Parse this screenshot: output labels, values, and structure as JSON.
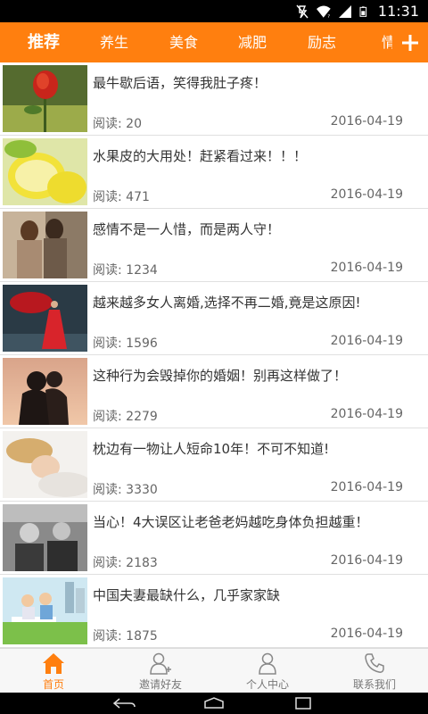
{
  "status_bar": {
    "time": "11:31"
  },
  "tabs": [
    {
      "label": "推荐",
      "active": true
    },
    {
      "label": "养生"
    },
    {
      "label": "美食"
    },
    {
      "label": "减肥"
    },
    {
      "label": "励志"
    },
    {
      "label": "情"
    }
  ],
  "add_icon": "plus-icon",
  "articles": [
    {
      "title": "最牛歇后语，笑得我肚子疼！",
      "reads": "阅读: 20",
      "date": "2016-04-19",
      "thumb": "red-rose"
    },
    {
      "title": "水果皮的大用处！赶紧看过来！！！",
      "reads": "阅读: 471",
      "date": "2016-04-19",
      "thumb": "lemon"
    },
    {
      "title": "感情不是一人惜，而是两人守！",
      "reads": "阅读: 1234",
      "date": "2016-04-19",
      "thumb": "couple-hug"
    },
    {
      "title": "越来越多女人离婚,选择不再二婚,竟是这原因!",
      "reads": "阅读: 1596",
      "date": "2016-04-19",
      "thumb": "woman-red-dress"
    },
    {
      "title": "这种行为会毁掉你的婚姻！别再这样做了！",
      "reads": "阅读: 2279",
      "date": "2016-04-19",
      "thumb": "couple-silhouette"
    },
    {
      "title": "枕边有一物让人短命10年！不可不知道!",
      "reads": "阅读: 3330",
      "date": "2016-04-19",
      "thumb": "sleeping-woman"
    },
    {
      "title": "当心！4大误区让老爸老妈越吃身体负担越重！",
      "reads": "阅读: 2183",
      "date": "2016-04-19",
      "thumb": "elderly-couple"
    },
    {
      "title": "中国夫妻最缺什么，几乎家家缺",
      "reads": "阅读: 1875",
      "date": "2016-04-19",
      "thumb": "cartoon-couple"
    }
  ],
  "bottom_nav": [
    {
      "label": "首页",
      "icon": "home-icon",
      "active": true
    },
    {
      "label": "邀请好友",
      "icon": "add-friend-icon"
    },
    {
      "label": "个人中心",
      "icon": "person-icon"
    },
    {
      "label": "联系我们",
      "icon": "phone-icon"
    }
  ],
  "colors": {
    "accent": "#ff7f0f",
    "text": "#333333",
    "meta": "#666666"
  }
}
